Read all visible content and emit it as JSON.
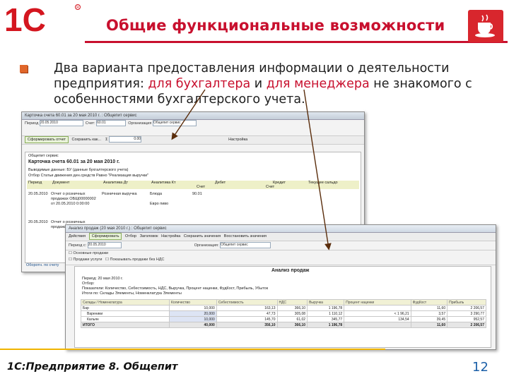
{
  "header": {
    "logo_text": "1С",
    "title": "Общие функциональные возможности",
    "brand_red": "#c8102e",
    "cup_icon": "coffee-cup-icon"
  },
  "bullet": {
    "line1": "Два варианта предоставления информации о деятельности",
    "line2_pre": "предприятия: ",
    "line2_red1": "для бухгалтера",
    "line2_mid": " и ",
    "line2_red2": "для менеджера",
    "line2_post": " не знакомого с",
    "line3": "особенностями бухгалтерского учета."
  },
  "window_accounting": {
    "title": "Карточка счета 60.01 за 20 мая 2010 г. : Общепит сервис",
    "fields": {
      "period_label": "Период",
      "period_value": "20.05.2010",
      "account_label": "Счет:",
      "account_value": "60.01",
      "org_label": "Организация",
      "org_value": "Общепит сервис"
    },
    "toolbar": {
      "generate": "Сформировать отчет",
      "save": "Сохранить как...",
      "sigma": "Σ",
      "sum_value": "0.00",
      "settings": "Настройка"
    },
    "report": {
      "company": "Общепит сервис",
      "title": "Карточка счета 60.01 за 20 мая 2010 г.",
      "line1": "Выводимые данные: БУ (данные бухгалтерского учета)",
      "line2": "Отбор      Статьи движения ден.средств Равно \"Реализация выручки\""
    },
    "columns": [
      "Период",
      "Документ",
      "Аналитика Дт",
      "Аналитика Кт",
      "Дебет",
      "Кредит",
      "Текущее сальдо"
    ],
    "subcolumns": [
      "Счет",
      "Счет"
    ],
    "rows": [
      {
        "period": "20.05.2010",
        "document": "Отчет о розничных продажах ОБЩ00000002 от 20.05.2010 0:00:00",
        "dt": "Розничная выручка",
        "kt": "Блюда",
        "debit": "90.01",
        "credit": "",
        "saldo": "Евро пиво"
      },
      {
        "period": "20.05.2010",
        "document": "Отчет о розничных продажах ОБЩ00000003",
        "dt": "",
        "kt": "",
        "debit": "",
        "credit": "",
        "saldo": ""
      }
    ],
    "status": "Оборотн. по счету"
  },
  "window_manager": {
    "title": "Анализ продаж (20 мая 2010 г.) : Общепит сервис",
    "menu": [
      "Действия",
      "Сформировать",
      "Отбор",
      "Заголовок",
      "Настройка",
      "Сохранить значения",
      "Восстановить значения"
    ],
    "filters": {
      "period_label": "Период с:",
      "period_value": "20.05.2010",
      "org_label": "Организация:",
      "org_value": "Общепит сервис",
      "checkbox1": "Основные продажи",
      "checkbox2": "Продажи услуги",
      "checkbox3": "Показывать продажи без НДС"
    },
    "report": {
      "title": "Анализ продаж",
      "period_line": "Период: 20 мая 2010 г.",
      "filter_line": "Отбор:",
      "indicators_line": "Показатели: Количество, Себестоимость, НДС, Выручка, Процент наценки, ФудКост, Прибыль, Убыток",
      "totals_line": "Итоги по: Склады Элементы, Номенклатура Элементы"
    },
    "columns": [
      "Склады / Номенклатура",
      "Количество",
      "Себестоимость",
      "НДС",
      "Выручка",
      "Процент наценки",
      "ФудКост",
      "Прибыль"
    ],
    "rows": [
      {
        "name": "Бар",
        "qty": "10,000",
        "cost": "163,13",
        "vat": "366,10",
        "revenue": "1 196,78",
        "markup": "",
        "foodcost": "11,60",
        "profit": "2 206,57"
      },
      {
        "name": "Вареники",
        "qty": "20,000",
        "cost": "47,73",
        "vat": "305,08",
        "revenue": "1 110,12",
        "markup": "< 1 96,21",
        "foodcost": "3,57",
        "profit": "3 290,77"
      },
      {
        "name": "Кальян",
        "qty": "10,000",
        "cost": "145,70",
        "vat": "61,02",
        "revenue": "345,77",
        "markup": "134,54",
        "foodcost": "39,45",
        "profit": "952,57"
      },
      {
        "name": "ИТОГО",
        "qty": "40,000",
        "cost": "356,10",
        "vat": "366,10",
        "revenue": "1 196,78",
        "markup": "",
        "foodcost": "11,60",
        "profit": "2 206,57"
      }
    ]
  },
  "footer": {
    "product": "1С:Предприятие 8. Общепит",
    "page_number": "12",
    "line_color": "#f0b400"
  }
}
